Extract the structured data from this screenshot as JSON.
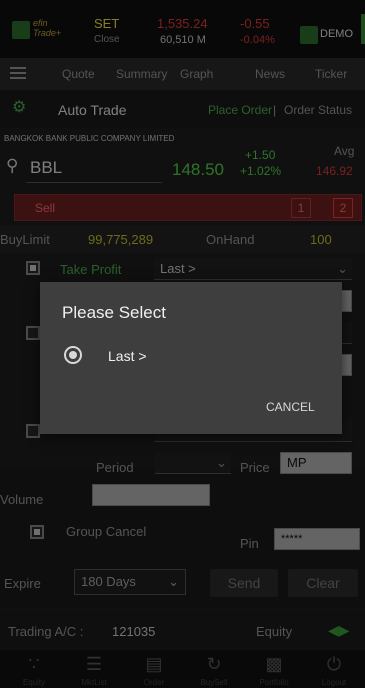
{
  "market": {
    "app_name": "efin Trade+",
    "index_name": "SET",
    "index_sub": "Close",
    "index_value": "1,535.24",
    "volume": "60,510 M",
    "change": "-0.55",
    "change_pct": "-0.04%",
    "mode": "DEMO"
  },
  "menu": {
    "items": [
      "Quote",
      "Summary",
      "Graph",
      "News",
      "Ticker"
    ]
  },
  "trade_bar": {
    "title": "Auto Trade",
    "place_order": "Place Order",
    "separator": "|",
    "order_status": "Order Status"
  },
  "stock": {
    "company": "BANGKOK BANK PUBLIC COMPANY LIMITED",
    "symbol": "BBL",
    "price": "148.50",
    "change": "+1.50",
    "change_pct": "+1.02%",
    "avg_label": "Avg",
    "avg_value": "146.92"
  },
  "sell_bar": {
    "label": "Sell",
    "box1": "1",
    "box2": "2"
  },
  "limits": {
    "buylimit_label": "BuyLimit",
    "buylimit_value": "99,775,289",
    "onhand_label": "OnHand",
    "onhand_value": "100"
  },
  "form": {
    "take_profit_label": "Take Profit",
    "take_profit_select": "Last >",
    "period_label": "Period",
    "price_label": "Price",
    "price_value": "MP",
    "volume_label": "Volume",
    "group_cancel_label": "Group Cancel",
    "pin_label": "Pin",
    "pin_value": "*****",
    "expire_label": "Expire",
    "expire_value": "180 Days",
    "send_label": "Send",
    "clear_label": "Clear"
  },
  "account": {
    "label": "Trading A/C :",
    "number": "121035",
    "equity": "Equity"
  },
  "bottom_nav": {
    "items": [
      "Equity",
      "MktList",
      "Order",
      "BuySell",
      "Portfolio",
      "Logout"
    ]
  },
  "dialog": {
    "title": "Please Select",
    "option": "Last >",
    "cancel": "CANCEL"
  },
  "colors": {
    "accent_green": "#4caf50",
    "up_green": "#54d44a",
    "down_red": "#e03a3a",
    "limit_yellow": "#c9c12a"
  }
}
